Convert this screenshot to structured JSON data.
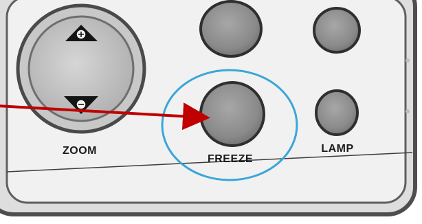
{
  "panel": {
    "labels": {
      "zoom": "ZOOM",
      "freeze": "FREEZE",
      "lamp": "LAMP"
    }
  },
  "icons": {
    "zoom_in": "plus-circle-icon",
    "zoom_out": "minus-circle-icon",
    "pointer": "red-arrow"
  },
  "colors": {
    "panel_bg": "#e9e9e9",
    "panel_border": "#5a5a5a",
    "button_fill": "#8f8f8f",
    "button_ring": "#2f2f2f",
    "highlight_ring": "#3aa6d8",
    "arrow": "#c00000"
  }
}
